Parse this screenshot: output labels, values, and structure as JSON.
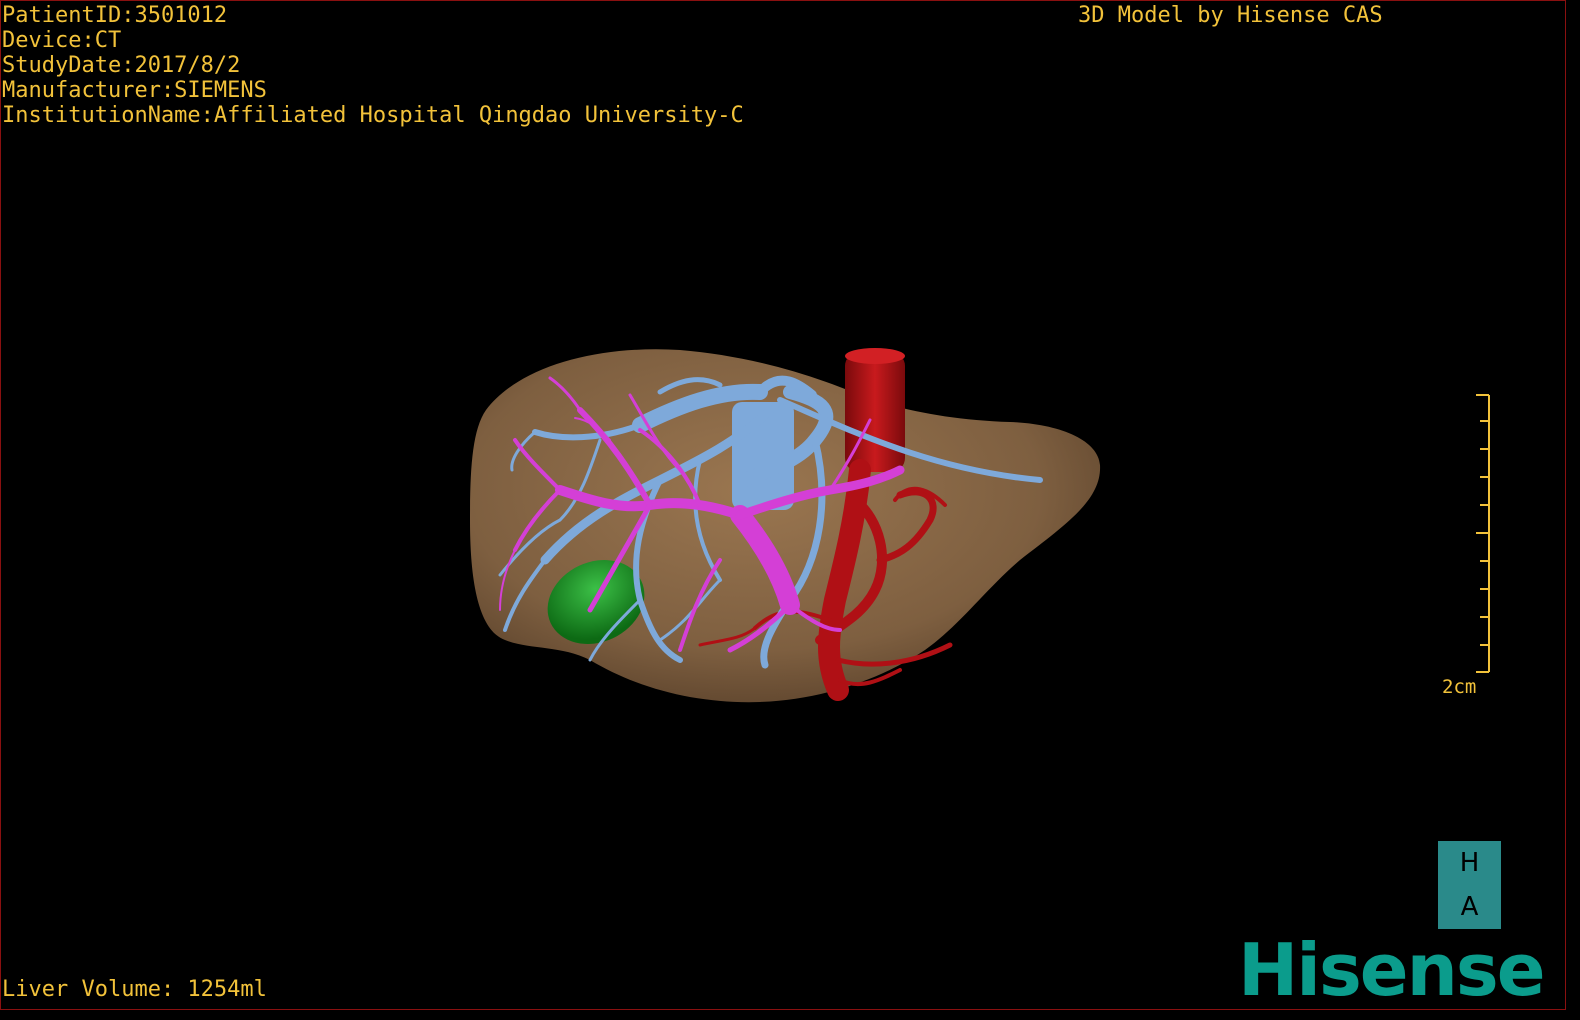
{
  "overlay": {
    "patient_id": "PatientID:3501012",
    "device": "Device:CT",
    "study_date": "StudyDate:2017/8/2",
    "manufacturer": "Manufacturer:SIEMENS",
    "institution": "InstitutionName:Affiliated Hospital Qingdao University-C",
    "model_credit": "3D Model by Hisense CAS",
    "liver_volume": "Liver Volume: 1254ml"
  },
  "scale_bar": {
    "label": "2cm"
  },
  "orientation": {
    "top": "H",
    "bottom": "A"
  },
  "logo": {
    "text": "Hisense"
  },
  "colors": {
    "overlay_text": "#f2c23a",
    "liver": "#8c6a47",
    "hepatic_vein": "#7ea9da",
    "portal_vein": "#d43fd6",
    "artery": "#b01015",
    "gallbladder": "#138a1c",
    "logo": "#0b9c8c"
  },
  "structures": [
    "liver",
    "hepatic-veins",
    "portal-vein",
    "arteries",
    "inferior-vena-cava",
    "gallbladder"
  ]
}
